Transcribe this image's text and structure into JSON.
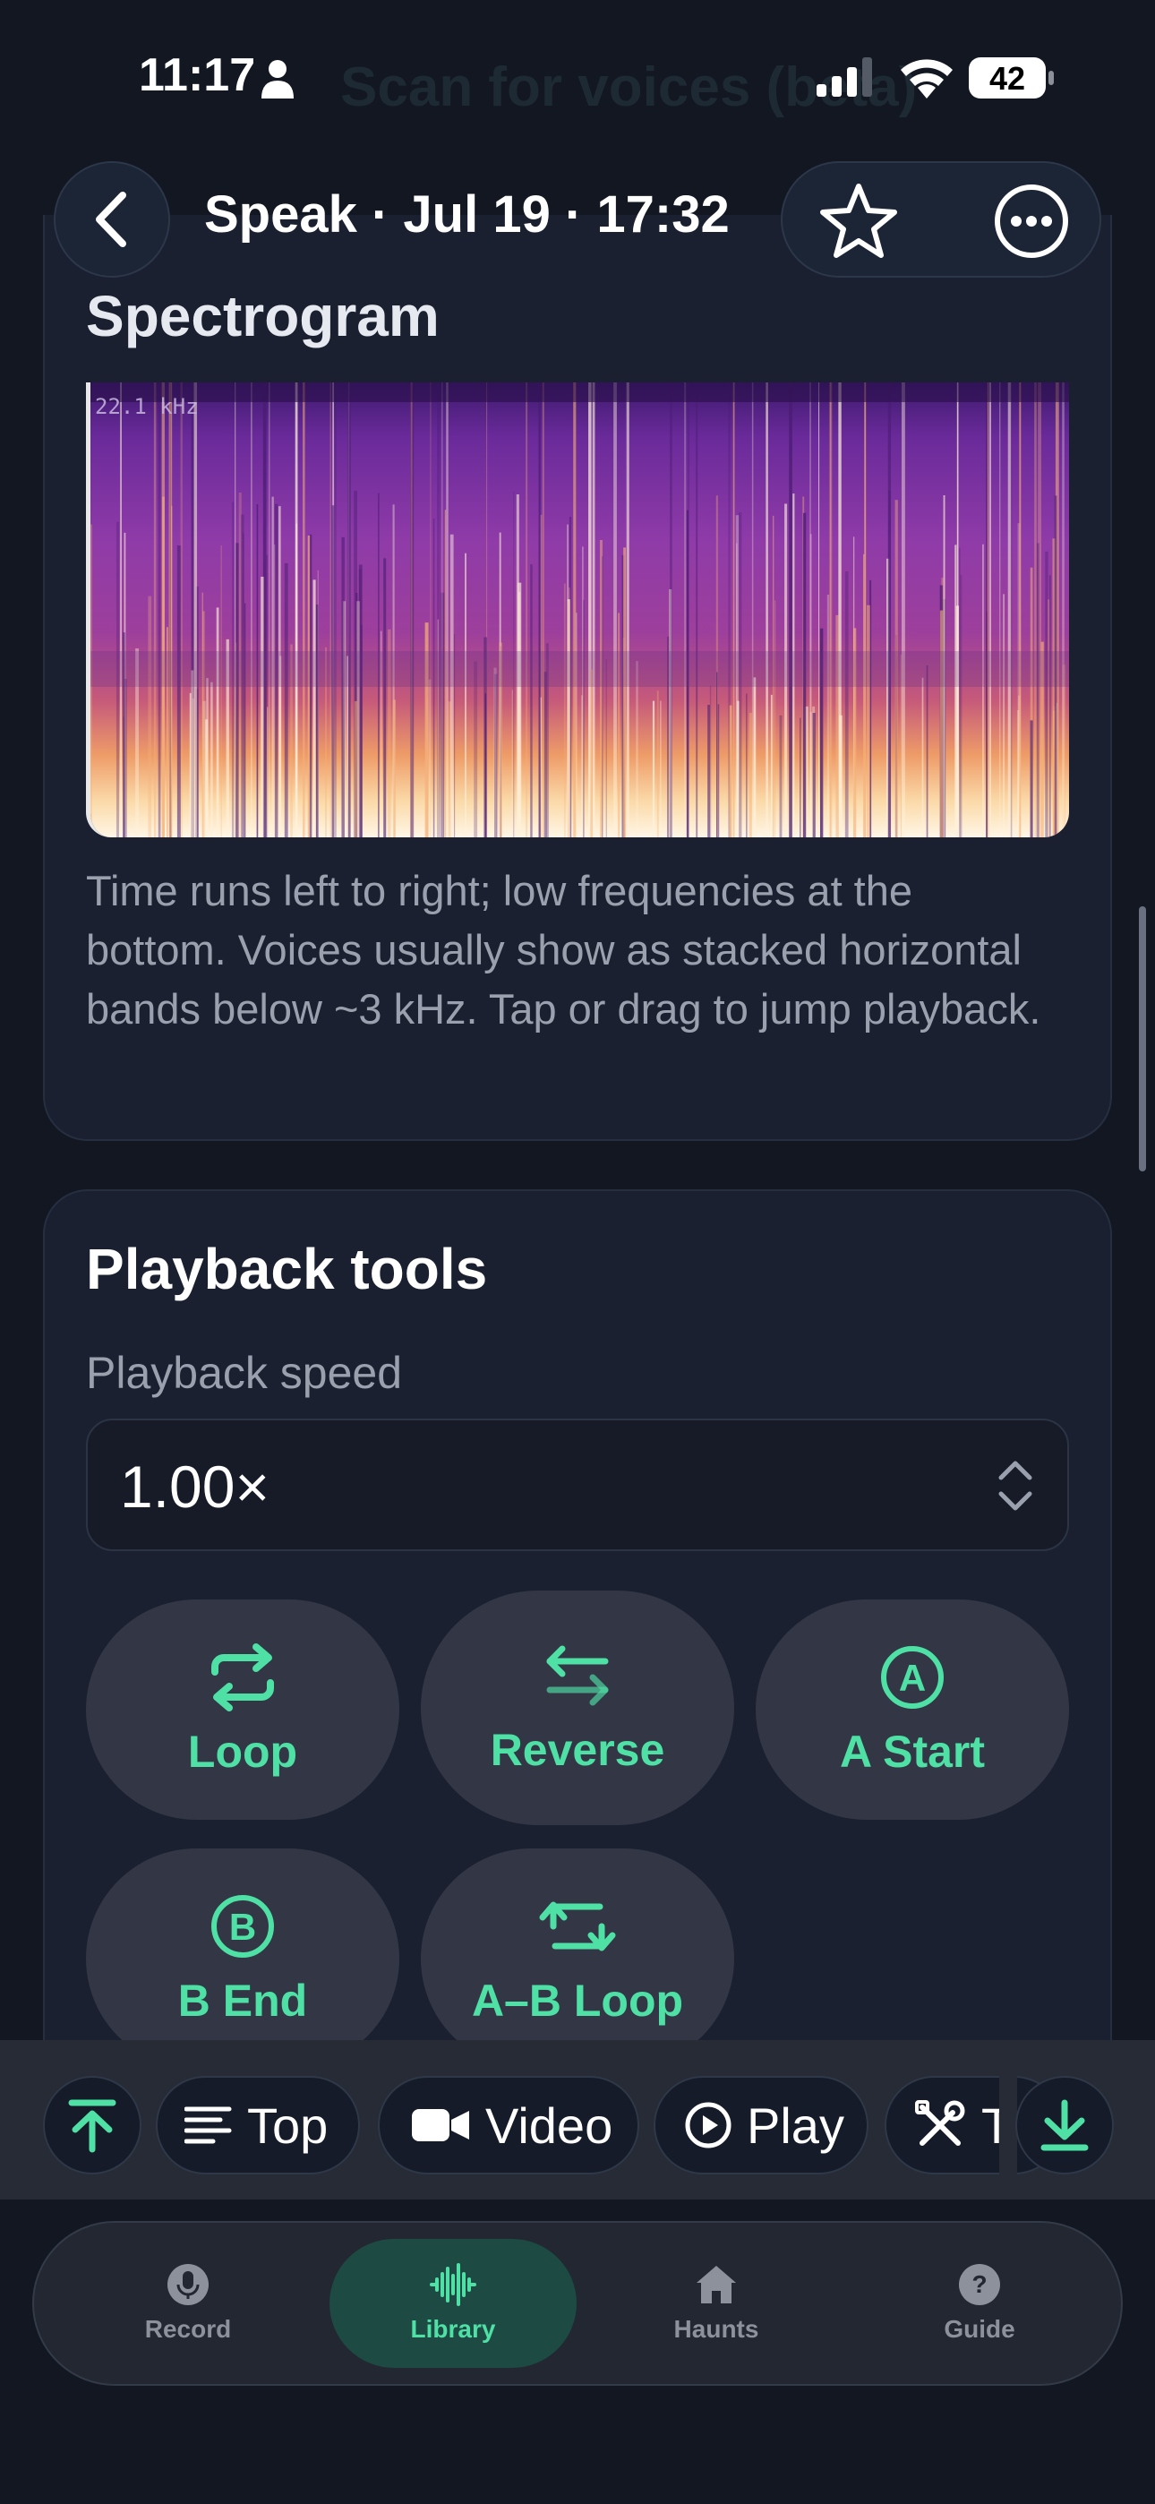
{
  "status_bar": {
    "time": "11:17",
    "battery": "42",
    "person_icon": "person-icon",
    "signal_icon": "cellular-signal-icon",
    "wifi_icon": "wifi-icon"
  },
  "background_text": "Scan for voices (beta)",
  "header": {
    "title": "Speak · Jul 19 · 17:32",
    "back_icon": "chevron-left-icon",
    "favorite_icon": "star-icon",
    "more_icon": "ellipsis-circle-icon"
  },
  "spectrogram": {
    "heading": "Spectrogram",
    "max_freq_label": "22.1 kHz",
    "description": "Time runs left to right; low frequencies at the bottom. Voices usually show as stacked horizontal bands below ~3 kHz. Tap or drag to jump playback."
  },
  "playback_tools": {
    "heading": "Playback tools",
    "speed_label": "Playback speed",
    "speed_value": "1.00×",
    "buttons": [
      {
        "label": "Loop",
        "icon": "repeat-icon"
      },
      {
        "label": "Reverse",
        "icon": "arrows-reverse-icon"
      },
      {
        "label": "A Start",
        "icon": "circle-a-icon"
      },
      {
        "label": "B End",
        "icon": "circle-b-icon"
      },
      {
        "label": "A–B Loop",
        "icon": "repeat-square-icon"
      }
    ]
  },
  "quick_jump": {
    "items": [
      {
        "label": "",
        "icon": "scroll-to-top-icon"
      },
      {
        "label": "Top",
        "icon": "text-align-left-icon"
      },
      {
        "label": "Video",
        "icon": "video-camera-icon"
      },
      {
        "label": "Play",
        "icon": "play-circle-icon"
      },
      {
        "label": "T",
        "icon": "tools-icon"
      },
      {
        "label": "",
        "icon": "download-icon"
      }
    ]
  },
  "tab_bar": {
    "tabs": [
      {
        "label": "Record",
        "icon": "microphone-icon",
        "active": false
      },
      {
        "label": "Library",
        "icon": "waveform-icon",
        "active": true
      },
      {
        "label": "Haunts",
        "icon": "house-icon",
        "active": false
      },
      {
        "label": "Guide",
        "icon": "question-circle-icon",
        "active": false
      }
    ]
  },
  "colors": {
    "background": "#121722",
    "card": "#1a2030",
    "accent": "#4fe0a5",
    "active_tab": "#1d4a43"
  }
}
